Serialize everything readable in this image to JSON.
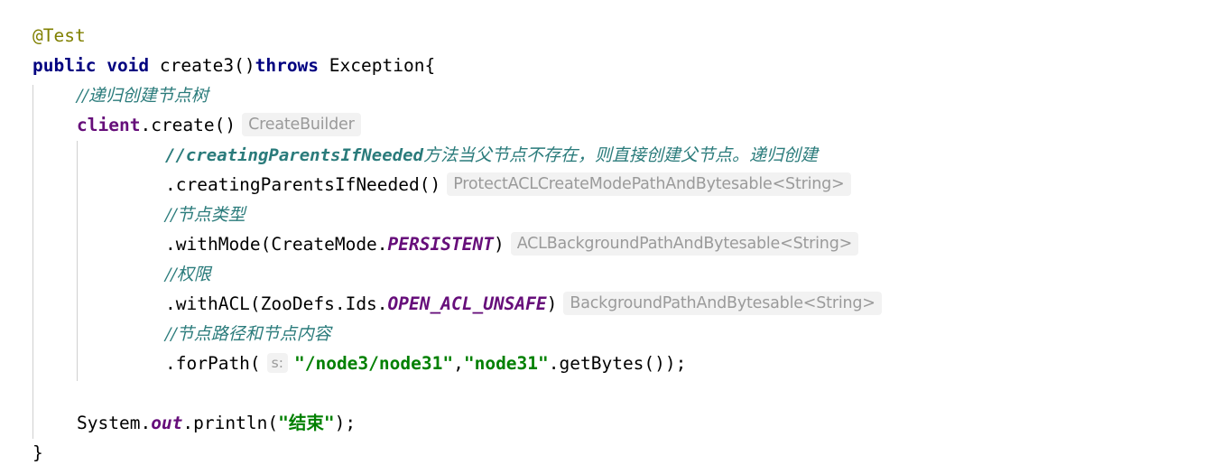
{
  "editor": {
    "language": "java",
    "background_color": "#ffffff",
    "colors": {
      "keyword": "#000080",
      "annotation": "#808000",
      "field": "#660e7a",
      "static_field": "#660e7a",
      "string": "#008000",
      "comment": "#2a7b7b",
      "inlay_hint_text": "#9a9a9a",
      "inlay_hint_background": "#f2f2f2",
      "indent_guide": "#d0d0d0",
      "default_text": "#000000"
    }
  },
  "code": {
    "line1": {
      "annotation": "@Test"
    },
    "line2": {
      "kw_public": "public",
      "sp1": " ",
      "kw_void": "void",
      "sp2": " ",
      "method_name": "create3()",
      "kw_throws": "throws",
      "sp3": " ",
      "exception_type": "Exception",
      "open_brace": "{"
    },
    "line3": {
      "comment": "//递归创建节点树"
    },
    "line4": {
      "receiver": "client",
      "dot_create": ".create()",
      "inlay_hint": "CreateBuilder"
    },
    "line5": {
      "comment_code": "//creatingParentsIfNeeded",
      "comment_text": "方法当父节点不存在，则直接创建父节点。递归创建"
    },
    "line6": {
      "call": ".creatingParentsIfNeeded()",
      "inlay_hint": "ProtectACLCreateModePathAndBytesable<String>"
    },
    "line7": {
      "comment": "//节点类型"
    },
    "line8": {
      "call_prefix": ".withMode(CreateMode.",
      "constant": "PERSISTENT",
      "call_suffix": ")",
      "inlay_hint": "ACLBackgroundPathAndBytesable<String>"
    },
    "line9": {
      "comment": "//权限"
    },
    "line10": {
      "call_prefix": ".withACL(ZooDefs.Ids.",
      "constant": "OPEN_ACL_UNSAFE",
      "call_suffix": ")",
      "inlay_hint": "BackgroundPathAndBytesable<String>"
    },
    "line11": {
      "comment": "//节点路径和节点内容"
    },
    "line12": {
      "call_prefix": ".forPath(",
      "param_hint": "s:",
      "arg_path": "\"/node3/node31\"",
      "comma": ",",
      "arg_content": "\"node31\"",
      "call_suffix": ".getBytes());"
    },
    "line13": {
      "blank": ""
    },
    "line14": {
      "receiver": "System.",
      "static_field": "out",
      "call_prefix": ".println(",
      "arg": "\"结束\"",
      "call_suffix": ");"
    },
    "line15": {
      "close_brace": "}"
    }
  }
}
